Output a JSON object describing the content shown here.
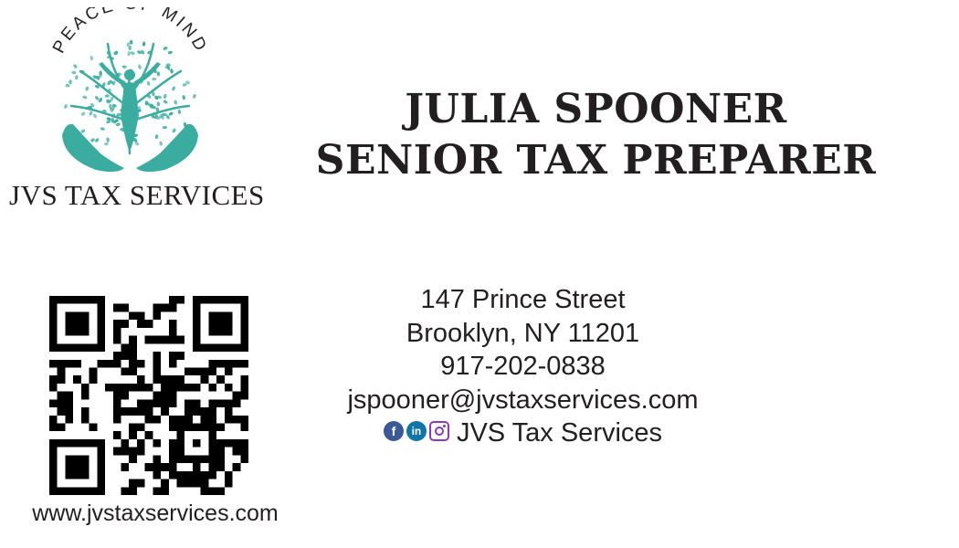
{
  "logo": {
    "tagline": "PEACE OF MIND",
    "company": "JVS TAX SERVICES",
    "accent_color": "#3aada0",
    "icon": "tree-of-life-hands-icon"
  },
  "heading": {
    "name": "JULIA SPOONER",
    "title": "SENIOR TAX PREPARER"
  },
  "contact": {
    "street": "147 Prince Street",
    "city": "Brooklyn, NY 11201",
    "phone": "917-202-0838",
    "email": "jspooner@jvstaxservices.com",
    "social_handle": "JVS Tax Services",
    "social_icons": [
      "facebook-icon",
      "linkedin-icon",
      "instagram-icon"
    ]
  },
  "website": "www.jvstaxservices.com",
  "qr_code": {
    "icon": "qr-code-icon"
  },
  "colors": {
    "text": "#231f20",
    "facebook": "#3b5998",
    "linkedin": "#0e76a8",
    "instagram": "#8a3ab9"
  }
}
